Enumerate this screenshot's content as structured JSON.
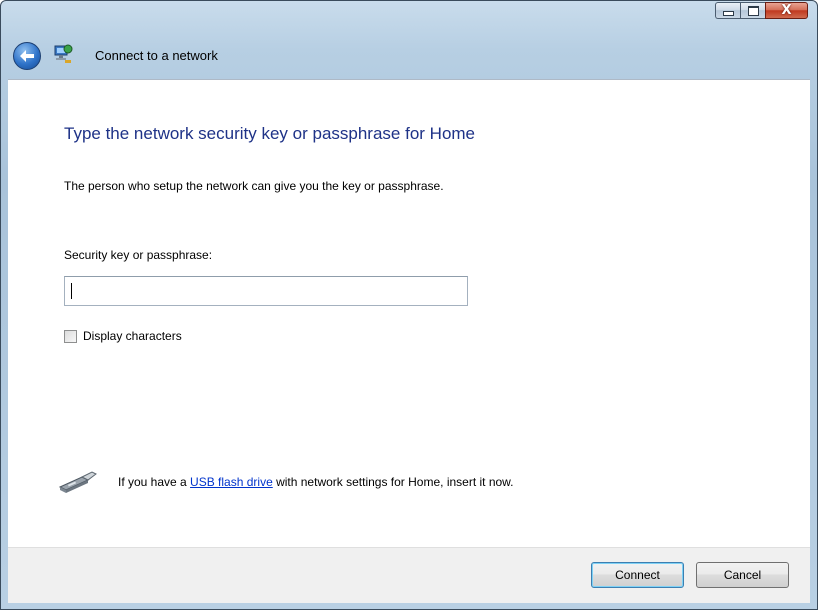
{
  "window": {
    "title": "Connect to a network",
    "close_glyph": "X"
  },
  "page": {
    "heading": "Type the network security key or passphrase for Home",
    "description": "The person who setup the network can give you the key or passphrase.",
    "key_label": "Security key or passphrase:",
    "key_value": "",
    "display_label": "Display characters",
    "display_checked": false
  },
  "usb_hint": {
    "prefix": "If you have a ",
    "link": "USB flash drive",
    "suffix": " with network settings for Home, insert it now."
  },
  "buttons": {
    "connect": "Connect",
    "cancel": "Cancel"
  },
  "colors": {
    "heading": "#1e3287",
    "link": "#0033cc",
    "footer": "#f0f0f0"
  },
  "icons": {
    "back": "back-arrow-icon",
    "network": "network-wizard-icon",
    "usb": "usb-flash-drive-icon"
  }
}
